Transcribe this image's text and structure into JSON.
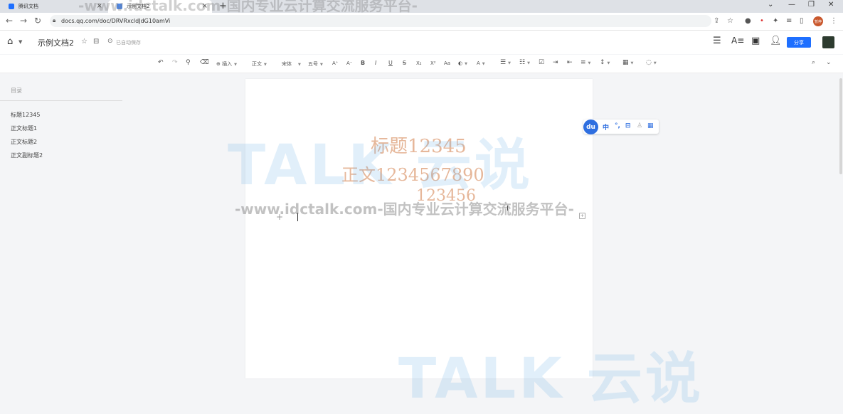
{
  "browser": {
    "tabs": [
      {
        "label": "腾讯文档",
        "color": "#1e6fff"
      },
      {
        "label": "示例文档2",
        "color": "#4a8af4"
      }
    ],
    "new_tab": "+",
    "url": "docs.qq.com/doc/DRVRxcldJdG10amVi",
    "profile_badge": "暂停"
  },
  "header": {
    "doc_title": "示例文档2",
    "saved_status": "已自动保存",
    "share_label": "分享"
  },
  "toolbar": {
    "insert_label": "插入",
    "style_label": "正文",
    "font_label": "宋体",
    "size_label": "五号"
  },
  "outline": {
    "title": "目录",
    "items": [
      "标题12345",
      "正文标题1",
      "正文标题2",
      "正文副标题2"
    ]
  },
  "document": {
    "heading": "标题12345",
    "body": "正文1234567890",
    "body2": "123456"
  },
  "ime": {
    "logo": "du",
    "mode": "中"
  },
  "watermark": {
    "logo": "TALK 云说",
    "line": "-www.idctalk.com-国内专业云计算交流服务平台-"
  }
}
